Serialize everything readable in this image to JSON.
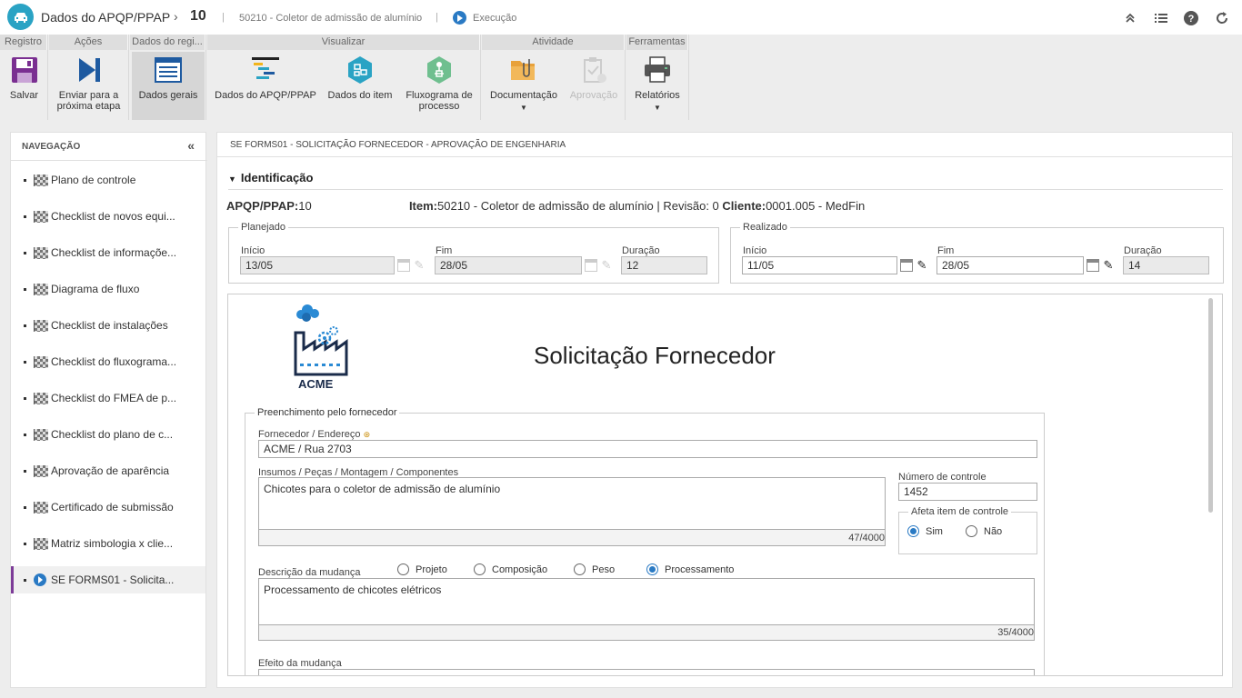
{
  "app": {
    "title": "Dados do APQP/PPAP",
    "record_number": "10",
    "record_desc": "50210 - Coletor de admissão de alumínio",
    "status": "Execução"
  },
  "ribbon": {
    "groups": {
      "registro": "Registro",
      "acoes": "Ações",
      "dados_registro": "Dados do regi...",
      "visualizar": "Visualizar",
      "atividade": "Atividade",
      "ferramentas": "Ferramentas"
    },
    "buttons": {
      "salvar": "Salvar",
      "enviar_line1": "Enviar para a",
      "enviar_line2": "próxima etapa",
      "dados_gerais": "Dados gerais",
      "dados_apqp": "Dados do APQP/PPAP",
      "dados_item": "Dados do item",
      "fluxograma_line1": "Fluxograma de",
      "fluxograma_line2": "processo",
      "documentacao": "Documentação",
      "aprovacao": "Aprovação",
      "relatorios": "Relatórios"
    }
  },
  "nav": {
    "title": "NAVEGAÇÃO",
    "items": [
      {
        "label": "Plano de controle"
      },
      {
        "label": "Checklist de novos equi..."
      },
      {
        "label": "Checklist de informaçõe..."
      },
      {
        "label": "Diagrama de fluxo"
      },
      {
        "label": "Checklist de instalações"
      },
      {
        "label": "Checklist do fluxograma..."
      },
      {
        "label": "Checklist do FMEA de p..."
      },
      {
        "label": "Checklist do plano de c..."
      },
      {
        "label": "Aprovação de aparência"
      },
      {
        "label": "Certificado de submissão"
      },
      {
        "label": "Matriz simbologia x clie..."
      },
      {
        "label": "SE FORMS01 - Solicita..."
      }
    ]
  },
  "main": {
    "header": "SE FORMS01 - SOLICITAÇÃO FORNECEDOR - APROVAÇÃO DE ENGENHARIA",
    "section": "Identificação",
    "id_row": {
      "apqp_label": "APQP/PPAP:",
      "apqp_value": "10",
      "item_label": "Item:",
      "item_value": "50210 - Coletor de admissão de alumínio | Revisão: 0",
      "cliente_label": "Cliente:",
      "cliente_value": "0001.005 - MedFin"
    },
    "planejado": {
      "legend": "Planejado",
      "inicio_label": "Início",
      "inicio": "13/05",
      "fim_label": "Fim",
      "fim": "28/05",
      "duracao_label": "Duração",
      "duracao": "12"
    },
    "realizado": {
      "legend": "Realizado",
      "inicio_label": "Início",
      "inicio": "11/05",
      "fim_label": "Fim",
      "fim": "28/05",
      "duracao_label": "Duração",
      "duracao": "14"
    }
  },
  "form": {
    "logo_text": "ACME",
    "title": "Solicitação Fornecedor",
    "fieldset": "Preenchimento pelo fornecedor",
    "fornecedor_label": "Fornecedor / Endereço",
    "fornecedor": "ACME / Rua 2703",
    "insumos_label": "Insumos / Peças / Montagem / Componentes",
    "insumos": "Chicotes para o coletor de admissão de alumínio",
    "insumos_count": "47/4000",
    "numero_label": "Número de controle",
    "numero": "1452",
    "afeta_legend": "Afeta item de controle",
    "afeta_sim": "Sim",
    "afeta_nao": "Não",
    "descricao_label": "Descrição da mudança",
    "opt_projeto": "Projeto",
    "opt_composicao": "Composição",
    "opt_peso": "Peso",
    "opt_processamento": "Processamento",
    "descricao": "Processamento de chicotes elétricos",
    "descricao_count": "35/4000",
    "efeito_label": "Efeito da mudança"
  },
  "colors": {
    "accent": "#2a7ac4",
    "nav_current": "#7d3c98",
    "logo_bg": "#2aa3c4"
  }
}
